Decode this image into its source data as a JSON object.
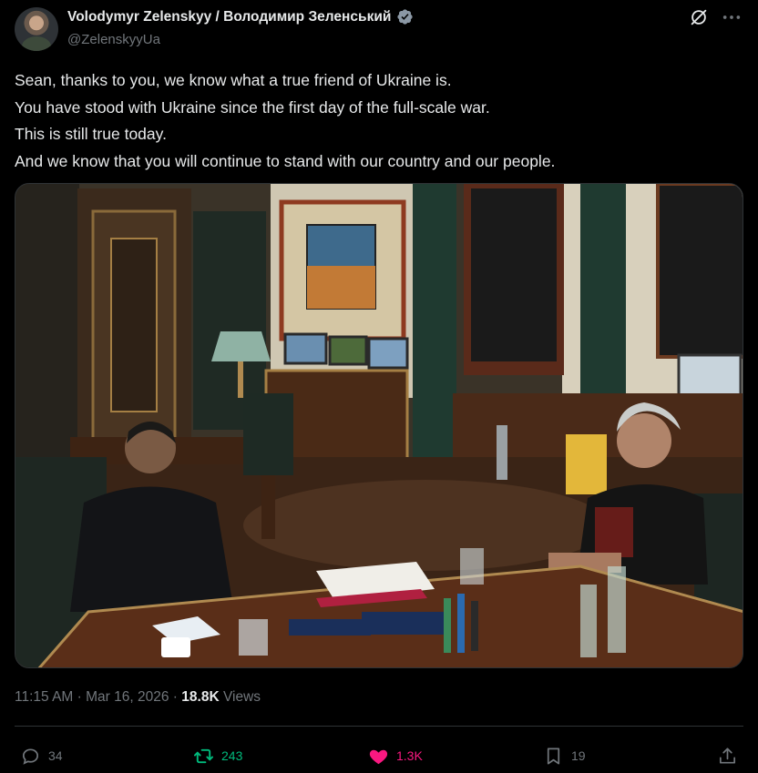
{
  "author": {
    "display_name": "Volodymyr Zelenskyy / Володимир Зеленський",
    "handle": "@ZelenskyyUa",
    "verified": true
  },
  "icons": {
    "verified": "verified-badge-icon",
    "grok": "grok-icon",
    "more": "more-icon",
    "reply": "reply-icon",
    "repost": "repost-icon",
    "like": "heart-icon",
    "bookmark": "bookmark-icon",
    "share": "share-icon"
  },
  "tweet": {
    "lines": [
      "Sean, thanks to you, we know what a true friend of Ukraine is.",
      "You have stood with Ukraine since the first day of the full-scale war.",
      "This is still true today.",
      "And we know that you will continue to stand with our country and our people."
    ]
  },
  "meta": {
    "time": "11:15 AM",
    "separator": "·",
    "date": "Mar 16, 2026",
    "views_count": "18.8K",
    "views_label": "Views"
  },
  "actions": {
    "replies": "34",
    "reposts": "243",
    "likes": "1.3K",
    "bookmarks": "19"
  },
  "colors": {
    "background": "#000000",
    "text": "#e7e9ea",
    "secondary": "#71767b",
    "border": "#2f3336",
    "verified": "#8b98a5",
    "repost_active": "#00ba7c",
    "like_active": "#f91880"
  }
}
